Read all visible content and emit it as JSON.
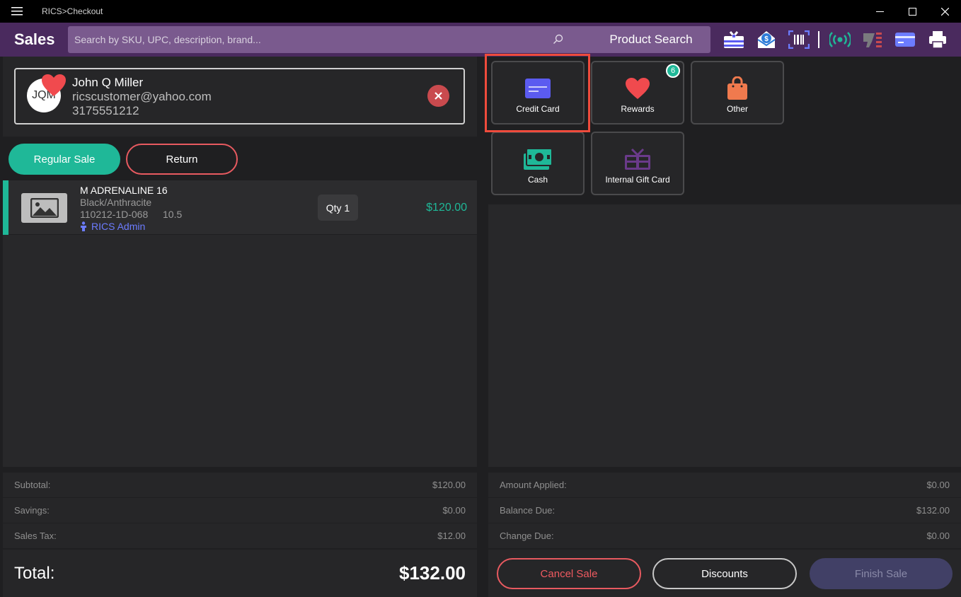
{
  "window": {
    "title": "RICS>Checkout"
  },
  "header": {
    "title": "Sales",
    "search_placeholder": "Search by SKU, UPC, description, brand...",
    "product_search_label": "Product Search",
    "icons": [
      "gift-receipt-icon",
      "email-receipt-icon",
      "barcode-scan-icon",
      "wireless-signal-icon",
      "pin-pad-icon",
      "credit-card-reader-icon",
      "printer-icon"
    ]
  },
  "customer": {
    "initials": "JQM",
    "name": "John Q Miller",
    "email": "ricscustomer@yahoo.com",
    "phone": "3175551212"
  },
  "sale_type": {
    "regular_label": "Regular Sale",
    "return_label": "Return"
  },
  "items": [
    {
      "name": "M ADRENALINE 16",
      "color": "Black/Anthracite",
      "sku": "110212-1D-068",
      "size": "10.5",
      "associate": "RICS Admin",
      "qty": "Qty 1",
      "price": "$120.00"
    }
  ],
  "summary": {
    "subtotal_label": "Subtotal:",
    "subtotal": "$120.00",
    "savings_label": "Savings:",
    "savings": "$0.00",
    "tax_label": "Sales Tax:",
    "tax": "$12.00",
    "total_label": "Total:",
    "total": "$132.00"
  },
  "tenders": [
    {
      "label": "Credit Card",
      "icon": "credit-card-icon",
      "color": "#5b5bf0",
      "selected": true
    },
    {
      "label": "Rewards",
      "icon": "heart-icon",
      "color": "#f04a4e",
      "badge": "6"
    },
    {
      "label": "Other",
      "icon": "shopping-bag-icon",
      "color": "#f07a4e"
    },
    {
      "label": "Cash",
      "icon": "cash-icon",
      "color": "#1fb898"
    },
    {
      "label": "Internal Gift Card",
      "icon": "gift-card-icon",
      "color": "#6a3a8a"
    }
  ],
  "payment": {
    "applied_label": "Amount Applied:",
    "applied": "$0.00",
    "balance_label": "Balance Due:",
    "balance": "$132.00",
    "change_label": "Change Due:",
    "change": "$0.00"
  },
  "actions": {
    "cancel_label": "Cancel Sale",
    "discounts_label": "Discounts",
    "finish_label": "Finish Sale"
  },
  "colors": {
    "header": "#4a2a5e",
    "accent": "#1fb898",
    "danger": "#e85a60",
    "highlight": "#ef4b3c"
  }
}
